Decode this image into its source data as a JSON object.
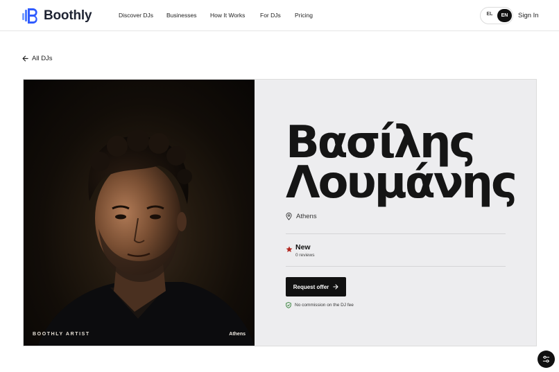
{
  "brand": {
    "name": "Boothly",
    "logo_color": "#2f5bff"
  },
  "nav": {
    "items": [
      "Discover DJs",
      "Businesses",
      "How It Works",
      "For DJs",
      "Pricing"
    ]
  },
  "language": {
    "options": [
      "EL",
      "EN"
    ],
    "selected": "EN"
  },
  "auth": {
    "sign_in_label": "Sign In"
  },
  "back_link": {
    "label": "All DJs",
    "icon": "arrow-left-icon"
  },
  "profile": {
    "photo_caption": "BOOTHLY ARTIST",
    "photo_city": "Athens",
    "name_line1": "Βασίλης",
    "name_line2": "Λουμάνης",
    "location": "Athens",
    "rating_label": "New",
    "reviews_text": "0 reviews",
    "cta_label": "Request offer",
    "commission_note": "No commission on the DJ fee",
    "accent_color": "#b3261e"
  },
  "fab": {
    "icon": "filter-sliders-icon"
  }
}
